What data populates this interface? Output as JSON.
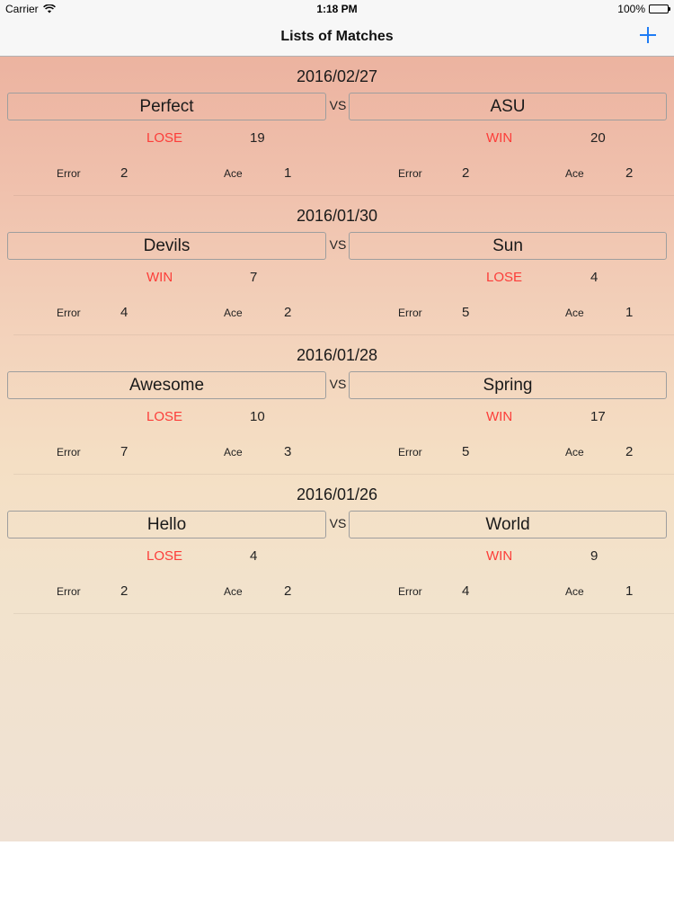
{
  "status_bar": {
    "carrier": "Carrier",
    "time": "1:18 PM",
    "battery": "100%"
  },
  "nav": {
    "title": "Lists of Matches",
    "add_icon": "plus-icon"
  },
  "colors": {
    "accent": "#1f7cf5",
    "result_text": "#fc3d39"
  },
  "vs_label": "VS",
  "labels": {
    "error": "Error",
    "ace": "Ace"
  },
  "matches": [
    {
      "date": "2016/02/27",
      "left": {
        "name": "Perfect",
        "result": "LOSE",
        "score": "19",
        "error": "2",
        "ace": "1"
      },
      "right": {
        "name": "ASU",
        "result": "WIN",
        "score": "20",
        "error": "2",
        "ace": "2"
      }
    },
    {
      "date": "2016/01/30",
      "left": {
        "name": "Devils",
        "result": "WIN",
        "score": "7",
        "error": "4",
        "ace": "2"
      },
      "right": {
        "name": "Sun",
        "result": "LOSE",
        "score": "4",
        "error": "5",
        "ace": "1"
      }
    },
    {
      "date": "2016/01/28",
      "left": {
        "name": "Awesome",
        "result": "LOSE",
        "score": "10",
        "error": "7",
        "ace": "3"
      },
      "right": {
        "name": "Spring",
        "result": "WIN",
        "score": "17",
        "error": "5",
        "ace": "2"
      }
    },
    {
      "date": "2016/01/26",
      "left": {
        "name": "Hello",
        "result": "LOSE",
        "score": "4",
        "error": "2",
        "ace": "2"
      },
      "right": {
        "name": "World",
        "result": "WIN",
        "score": "9",
        "error": "4",
        "ace": "1"
      }
    }
  ]
}
